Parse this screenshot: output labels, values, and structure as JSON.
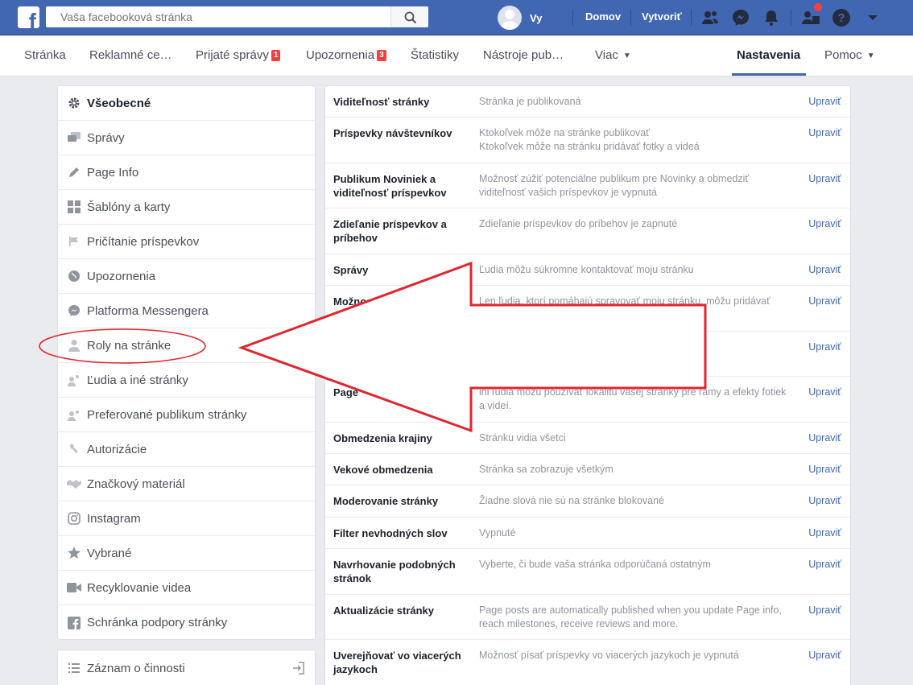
{
  "topbar": {
    "search_placeholder": "Vaša facebooková stránka",
    "user_name": "Vy",
    "home_link": "Domov",
    "create_link": "Vytvoriť"
  },
  "pagenav": {
    "items": [
      {
        "label": "Stránka"
      },
      {
        "label": "Reklamné ce…"
      },
      {
        "label": "Prijaté správy",
        "badge": "1"
      },
      {
        "label": "Upozornenia",
        "badge": "3"
      },
      {
        "label": "Štatistiky"
      },
      {
        "label": "Nástroje pub…"
      },
      {
        "label": "Viac"
      },
      {
        "label": "Nastavenia"
      },
      {
        "label": "Pomoc"
      }
    ]
  },
  "leftmenu": {
    "items": [
      {
        "label": "Všeobecné",
        "icon": "gear-icon"
      },
      {
        "label": "Správy",
        "icon": "messages-icon"
      },
      {
        "label": "Page Info",
        "icon": "pencil-icon"
      },
      {
        "label": "Šablóny a karty",
        "icon": "grid-icon"
      },
      {
        "label": "Pričítanie príspevkov",
        "icon": "flag-icon"
      },
      {
        "label": "Upozornenia",
        "icon": "globe-icon"
      },
      {
        "label": "Platforma Messengera",
        "icon": "messenger-icon"
      },
      {
        "label": "Roly na stránke",
        "icon": "person-icon"
      },
      {
        "label": "Ľudia a iné stránky",
        "icon": "people-icon"
      },
      {
        "label": "Preferované publikum stránky",
        "icon": "audience-icon"
      },
      {
        "label": "Autorizácie",
        "icon": "wrench-icon"
      },
      {
        "label": "Značkový materiál",
        "icon": "handshake-icon"
      },
      {
        "label": "Instagram",
        "icon": "instagram-icon"
      },
      {
        "label": "Vybrané",
        "icon": "star-icon"
      },
      {
        "label": "Recyklovanie videa",
        "icon": "video-icon"
      },
      {
        "label": "Schránka podpory stránky",
        "icon": "facebook-icon"
      }
    ],
    "activity_log": "Záznam o činnosti"
  },
  "settings": {
    "edit_label": "Upraviť",
    "rows": [
      {
        "label": "Viditeľnosť stránky",
        "value": "Stránka je publikovaná"
      },
      {
        "label": "Príspevky návštevníkov",
        "value": "Ktokoľvek môže na stránke publikovať\nKtokoľvek môže na stránku pridávať fotky a videá"
      },
      {
        "label": "Publikum Noviniek a viditeľnosť príspevkov",
        "value": "Možnosť zúžiť potenciálne publikum pre Novinky a obmedziť viditeľnosť vašich príspevkov je vypnutá"
      },
      {
        "label": "Zdieľanie príspevkov a príbehov",
        "value": "Zdieľanie príspevkov do príbehov je zapnuté"
      },
      {
        "label": "Správy",
        "value": "Ľudia môžu súkromne kontaktovať moju stránku"
      },
      {
        "label": "Možnost",
        "value": "Len ľudia, ktorí pomáhajú spravovať moju stránku, môžu pridávať"
      },
      {
        "label": "",
        "value": ""
      },
      {
        "label": "Page",
        "value": "ini ľudia môžu používať lokalitu vašej stránky pre rámy a efekty fotiek a videí."
      },
      {
        "label": "Obmedzenia krajiny",
        "value": "Stránku vidia všetci"
      },
      {
        "label": "Vekové obmedzenia",
        "value": "Stránka sa zobrazuje všetkým"
      },
      {
        "label": "Moderovanie stránky",
        "value": "Žiadne slová nie sú na stránke blokované"
      },
      {
        "label": "Filter nevhodných slov",
        "value": "Vypnuté"
      },
      {
        "label": "Navrhovanie podobných stránok",
        "value": "Vyberte, či bude vaša stránka odporúčaná ostatným"
      },
      {
        "label": "Aktualizácie stránky",
        "value": "Page posts are automatically published when you update Page info, reach milestones, receive reviews and more."
      },
      {
        "label": "Uverejňovať vo viacerých jazykoch",
        "value": "Možnosť písať príspevky vo viacerých jazykoch je vypnutá"
      }
    ]
  },
  "colors": {
    "brand_blue": "#4267b2",
    "annotation_red": "#e0262e",
    "badge_red": "#fa3e3e"
  }
}
